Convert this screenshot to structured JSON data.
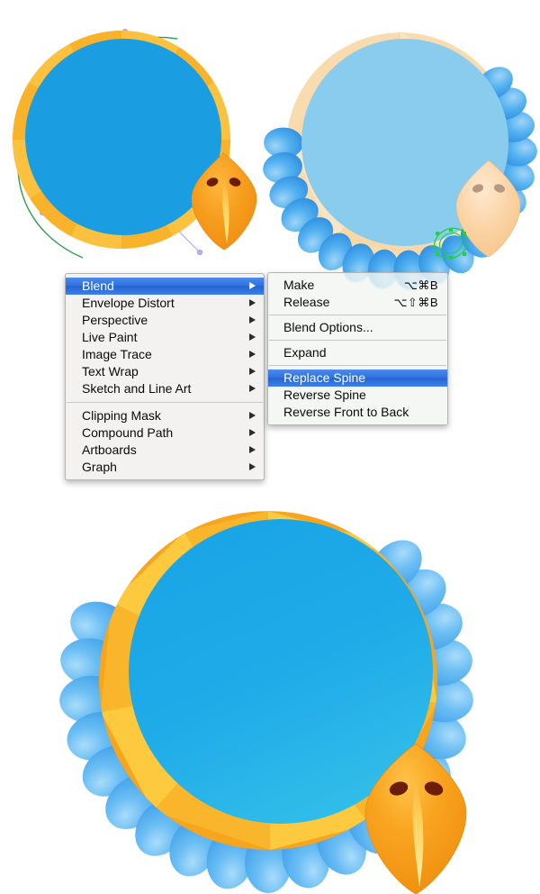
{
  "application": {
    "name": "Adobe Illustrator",
    "document_type": "vector-artwork"
  },
  "menus": {
    "object_menu": {
      "name": "Object submenu",
      "groups": [
        {
          "items": [
            {
              "label": "Blend",
              "has_submenu": true,
              "selected": true,
              "shortcut": ""
            },
            {
              "label": "Envelope Distort",
              "has_submenu": true,
              "selected": false,
              "shortcut": ""
            },
            {
              "label": "Perspective",
              "has_submenu": true,
              "selected": false,
              "shortcut": ""
            },
            {
              "label": "Live Paint",
              "has_submenu": true,
              "selected": false,
              "shortcut": ""
            },
            {
              "label": "Image Trace",
              "has_submenu": true,
              "selected": false,
              "shortcut": ""
            },
            {
              "label": "Text Wrap",
              "has_submenu": true,
              "selected": false,
              "shortcut": ""
            },
            {
              "label": "Sketch and Line Art",
              "has_submenu": true,
              "selected": false,
              "shortcut": ""
            }
          ]
        },
        {
          "items": [
            {
              "label": "Clipping Mask",
              "has_submenu": true,
              "selected": false,
              "shortcut": ""
            },
            {
              "label": "Compound Path",
              "has_submenu": true,
              "selected": false,
              "shortcut": ""
            },
            {
              "label": "Artboards",
              "has_submenu": true,
              "selected": false,
              "shortcut": ""
            },
            {
              "label": "Graph",
              "has_submenu": true,
              "selected": false,
              "shortcut": ""
            }
          ]
        }
      ]
    },
    "blend_submenu": {
      "name": "Blend submenu",
      "groups": [
        {
          "items": [
            {
              "label": "Make",
              "shortcut": "⌥⌘B",
              "selected": false
            },
            {
              "label": "Release",
              "shortcut": "⌥⇧⌘B",
              "selected": false
            }
          ]
        },
        {
          "items": [
            {
              "label": "Blend Options...",
              "shortcut": "",
              "selected": false
            }
          ]
        },
        {
          "items": [
            {
              "label": "Expand",
              "shortcut": "",
              "selected": false
            }
          ]
        },
        {
          "items": [
            {
              "label": "Replace Spine",
              "shortcut": "",
              "selected": true
            },
            {
              "label": "Reverse Spine",
              "shortcut": "",
              "selected": false
            },
            {
              "label": "Reverse Front to Back",
              "shortcut": "",
              "selected": false
            }
          ]
        }
      ]
    }
  },
  "artwork": {
    "top_left": {
      "name": "bird-with-segment-ring-and-spine-path",
      "description": "Blue circle with gold segmented ring, gold beak, and a green spine path with bezier handles",
      "circle_color": "#1b9de2",
      "ring_gold_light": "#fcc23f",
      "ring_gold_dark": "#f39c1b",
      "beak_color": "#f5a623",
      "spine_stroke": "#2e9e4f",
      "handle_color": "#a9a2ee",
      "anchor_color": "#2b3fd0",
      "ring_segments": 18
    },
    "top_right": {
      "name": "bird-with-petal-blend-faded",
      "description": "Faded artwork with blue petal blend following the left arc and a selected petal highlighted in green",
      "circle_color": "#8accee",
      "ring_color": "#f7d9a8",
      "petal_color": "#3ea8ef",
      "beak_color": "#fbd3a4",
      "selection_color": "#1fd13a",
      "petal_count": 24
    },
    "bottom": {
      "name": "bird-final-result",
      "description": "Final blended artwork: blue circle, gold ring, blue feather petals around the arc, gold beak",
      "circle_gradient_start": "#1ba7e8",
      "circle_gradient_end": "#29b6e8",
      "ring_gold_light": "#fcc93f",
      "ring_gold_dark": "#f29d1d",
      "petal_color_light": "#7fc8f5",
      "petal_color_dark": "#3f9fe8",
      "beak_gold": "#f79b1e",
      "beak_highlight": "#ffe866",
      "nostril_color": "#6b1d07",
      "petal_count": 26
    }
  }
}
